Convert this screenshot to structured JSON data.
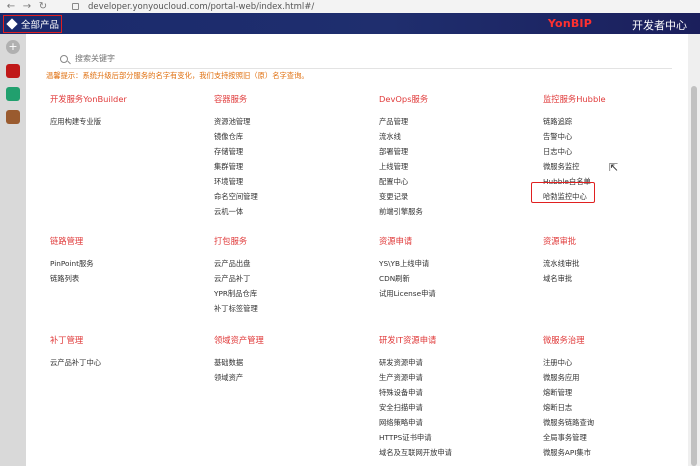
{
  "browser": {
    "back": "←",
    "forward": "→",
    "reload": "↻",
    "url": "developer.yonyoucloud.com/portal-web/index.html#/"
  },
  "header": {
    "all_products": "全部产品",
    "brand": "YonBIP",
    "brand_suffix": "开发者中心"
  },
  "rail": {
    "plus": "+"
  },
  "search": {
    "placeholder": "搜索关键字"
  },
  "notice": "温馨提示：系统升级后部分服务的名字有变化，我们支持按照旧（原）名字查询。",
  "sections": [
    {
      "title": "开发服务YonBuilder",
      "items": [
        "应用构建专业版"
      ]
    },
    {
      "title": "容器服务",
      "items": [
        "资源池管理",
        "镜像仓库",
        "存储管理",
        "集群管理",
        "环境管理",
        "命名空间管理",
        "云机一体"
      ]
    },
    {
      "title": "DevOps服务",
      "items": [
        "产品管理",
        "流水线",
        "部署管理",
        "上线管理",
        "配置中心",
        "变更记录",
        "前端引擎服务"
      ]
    },
    {
      "title": "监控服务Hubble",
      "items": [
        "链路追踪",
        "告警中心",
        "日志中心",
        "微服务监控",
        "Hubble白名单",
        "哈勃监控中心"
      ]
    },
    {
      "title": "链路管理",
      "items": [
        "PinPoint服务",
        "链路列表"
      ]
    },
    {
      "title": "打包服务",
      "items": [
        "云产品出盘",
        "云产品补丁",
        "YPR制品仓库",
        "补丁标签管理"
      ]
    },
    {
      "title": "资源申请",
      "items": [
        "YS\\YB上线申请",
        "CDN刷新",
        "试用License申请"
      ]
    },
    {
      "title": "资源审批",
      "items": [
        "流水线审批",
        "域名审批"
      ]
    },
    {
      "title": "补丁管理",
      "items": [
        "云产品补丁中心"
      ]
    },
    {
      "title": "领域资产管理",
      "items": [
        "基础数据",
        "领域资产"
      ]
    },
    {
      "title": "研发IT资源申请",
      "items": [
        "研发资源申请",
        "生产资源申请",
        "特殊设备申请",
        "安全扫描申请",
        "网络策略申请",
        "HTTPS证书申请",
        "域名及互联网开放申请"
      ]
    },
    {
      "title": "微服务治理",
      "items": [
        "注册中心",
        "微服务应用",
        "熔断管理",
        "熔断日志",
        "微服务链路查询",
        "全局事务管理",
        "微服务API集市"
      ]
    }
  ],
  "colors": {
    "accent_red": "#e03a3a",
    "notice_orange": "#e07010",
    "header_navy": "#1a2a6c"
  }
}
